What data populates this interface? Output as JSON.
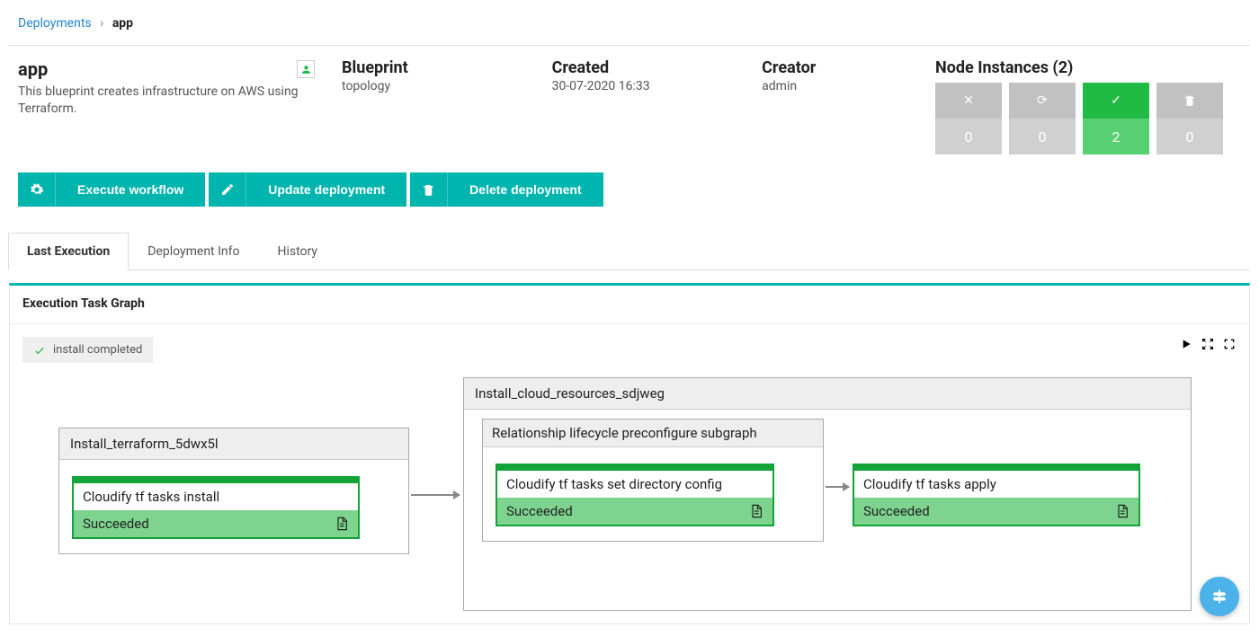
{
  "breadcrumb": {
    "root": "Deployments",
    "current": "app"
  },
  "deployment": {
    "name": "app",
    "description": "This blueprint creates infrastructure on AWS using Terraform."
  },
  "meta": {
    "blueprint_label": "Blueprint",
    "blueprint_value": "topology",
    "created_label": "Created",
    "created_value": "30-07-2020 16:33",
    "creator_label": "Creator",
    "creator_value": "admin"
  },
  "node_instances": {
    "label": "Node Instances (2)",
    "tiles": {
      "failed": "0",
      "loading": "0",
      "success": "2",
      "deleted": "0"
    }
  },
  "actions": {
    "execute": "Execute workflow",
    "update": "Update deployment",
    "delete": "Delete deployment"
  },
  "tabs": {
    "last_execution": "Last Execution",
    "deployment_info": "Deployment Info",
    "history": "History"
  },
  "panel": {
    "title": "Execution Task Graph",
    "status": "install completed"
  },
  "graph": {
    "box1_title": "Install_terraform_5dwx5l",
    "task1_title": "Cloudify tf tasks install",
    "task1_status": "Succeeded",
    "box2_title": "Install_cloud_resources_sdjweg",
    "sub_title": "Relationship lifecycle preconfigure subgraph",
    "task2_title": "Cloudify tf tasks set directory config",
    "task2_status": "Succeeded",
    "task3_title": "Cloudify tf tasks apply",
    "task3_status": "Succeeded"
  }
}
